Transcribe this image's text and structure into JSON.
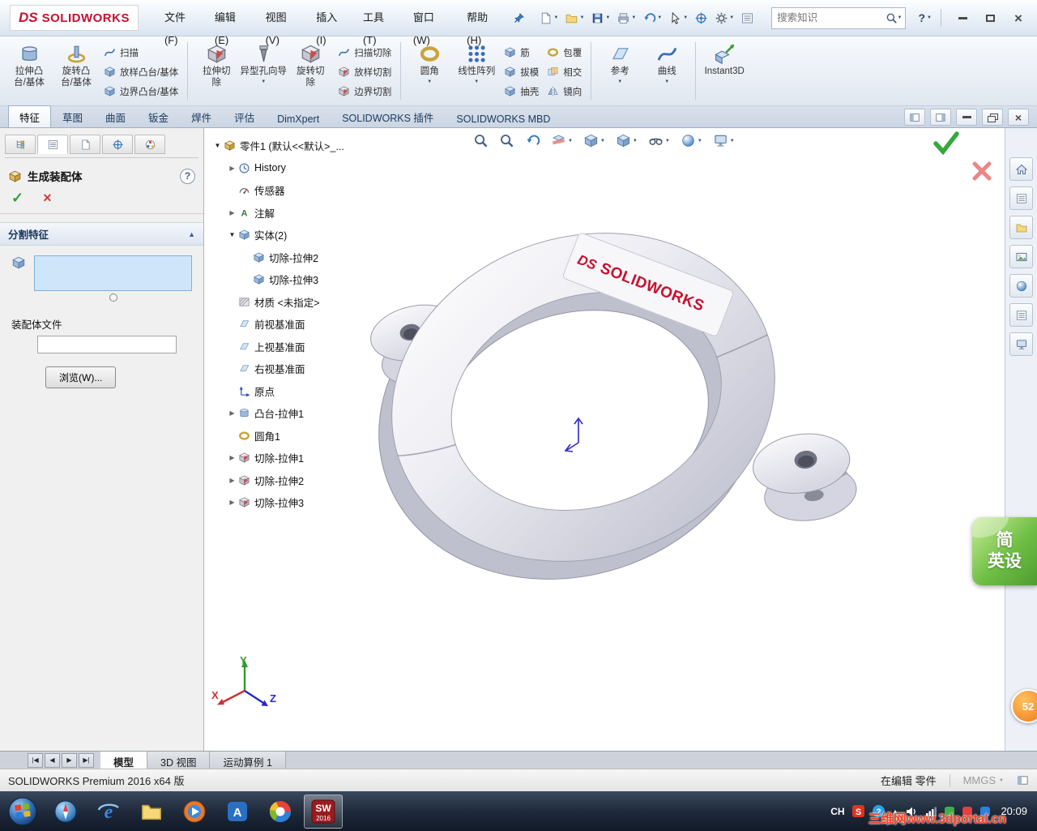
{
  "titlebar": {
    "logo_mark": "DS",
    "logo_text": "SOLIDWORKS",
    "menus": [
      "文件(F)",
      "编辑(E)",
      "视图(V)",
      "插入(I)",
      "工具(T)",
      "窗口(W)",
      "帮助(H)"
    ],
    "quick_buttons": [
      {
        "icon": "new-document",
        "caret": true
      },
      {
        "icon": "open",
        "caret": true
      },
      {
        "icon": "save",
        "caret": true
      },
      {
        "icon": "print",
        "caret": true
      },
      {
        "icon": "undo",
        "caret": true
      },
      {
        "icon": "select",
        "caret": true
      },
      {
        "icon": "rebuild",
        "caret": false
      },
      {
        "icon": "options",
        "caret": true
      },
      {
        "icon": "file-properties",
        "caret": false
      }
    ],
    "search_placeholder": "搜索知识",
    "help_label": "?"
  },
  "command_manager": {
    "tabs": [
      "特征",
      "草图",
      "曲面",
      "钣金",
      "焊件",
      "评估",
      "DimXpert",
      "SOLIDWORKS 插件",
      "SOLIDWORKS MBD"
    ],
    "active_tab": "特征",
    "groups": [
      {
        "columns": [
          {
            "type": "big",
            "icon": "boss-extrude",
            "label": "拉伸凸\n台/基体",
            "caret": false
          },
          {
            "type": "big",
            "icon": "revolve",
            "label": "旋转凸\n台/基体",
            "caret": false
          },
          {
            "type": "stack",
            "items": [
              {
                "icon": "sweep",
                "label": "扫描"
              },
              {
                "icon": "loft",
                "label": "放样凸台/基体"
              },
              {
                "icon": "boundary",
                "label": "边界凸台/基体"
              }
            ]
          }
        ]
      },
      {
        "columns": [
          {
            "type": "big",
            "icon": "cut-extrude",
            "label": "拉伸切\n除",
            "caret": false
          },
          {
            "type": "big",
            "icon": "hole-wizard",
            "label": "异型孔向导",
            "caret": true
          },
          {
            "type": "big",
            "icon": "revolved-cut",
            "label": "旋转切\n除",
            "caret": false
          },
          {
            "type": "stack",
            "items": [
              {
                "icon": "swept-cut",
                "label": "扫描切除"
              },
              {
                "icon": "lofted-cut",
                "label": "放样切割"
              },
              {
                "icon": "boundary-cut",
                "label": "边界切割"
              }
            ]
          }
        ]
      },
      {
        "columns": [
          {
            "type": "big",
            "icon": "fillet",
            "label": "圆角",
            "caret": true
          },
          {
            "type": "big",
            "icon": "linear-pattern",
            "label": "线性阵列",
            "caret": true
          },
          {
            "type": "stack",
            "items": [
              {
                "icon": "rib",
                "label": "筋"
              },
              {
                "icon": "draft",
                "label": "拔模"
              },
              {
                "icon": "shell",
                "label": "抽壳"
              }
            ]
          },
          {
            "type": "stack",
            "items": [
              {
                "icon": "wrap",
                "label": "包覆"
              },
              {
                "icon": "intersect",
                "label": "相交"
              },
              {
                "icon": "mirror",
                "label": "镜向"
              }
            ]
          }
        ]
      },
      {
        "columns": [
          {
            "type": "big",
            "icon": "reference-geometry",
            "label": "参考",
            "caret": true
          },
          {
            "type": "big",
            "icon": "curves",
            "label": "曲线",
            "caret": true
          }
        ]
      },
      {
        "columns": [
          {
            "type": "big",
            "icon": "instant3d",
            "label": "Instant3D",
            "caret": false
          }
        ]
      }
    ]
  },
  "property_manager": {
    "tabs": [
      "feature-manager",
      "property-manager",
      "configuration-manager",
      "dimxpert-manager",
      "display-manager"
    ],
    "title": "生成装配体",
    "help": "?",
    "split_group_title": "分割特征",
    "assembly_file_label": "装配体文件",
    "browse_label": "浏览(W)..."
  },
  "feature_tree": {
    "items": [
      {
        "label": "零件1 (默认<<默认>_...",
        "icon": "part",
        "indent": 0,
        "expander": "expanded"
      },
      {
        "label": "History",
        "icon": "history",
        "indent": 1,
        "expander": "collapsed"
      },
      {
        "label": "传感器",
        "icon": "sensors",
        "indent": 1,
        "expander": "none"
      },
      {
        "label": "注解",
        "icon": "annotations",
        "indent": 1,
        "expander": "collapsed"
      },
      {
        "label": "实体(2)",
        "icon": "solid-bodies",
        "indent": 1,
        "expander": "expanded"
      },
      {
        "label": "切除-拉伸2",
        "icon": "solid-body",
        "indent": 2,
        "expander": "none"
      },
      {
        "label": "切除-拉伸3",
        "icon": "solid-body",
        "indent": 2,
        "expander": "none"
      },
      {
        "label": "材质 <未指定>",
        "icon": "material",
        "indent": 1,
        "expander": "none"
      },
      {
        "label": "前视基准面",
        "icon": "plane",
        "indent": 1,
        "expander": "none"
      },
      {
        "label": "上视基准面",
        "icon": "plane",
        "indent": 1,
        "expander": "none"
      },
      {
        "label": "右视基准面",
        "icon": "plane",
        "indent": 1,
        "expander": "none"
      },
      {
        "label": "原点",
        "icon": "origin",
        "indent": 1,
        "expander": "none"
      },
      {
        "label": "凸台-拉伸1",
        "icon": "boss-extrude",
        "indent": 1,
        "expander": "collapsed"
      },
      {
        "label": "圆角1",
        "icon": "fillet",
        "indent": 1,
        "expander": "none"
      },
      {
        "label": "切除-拉伸1",
        "icon": "cut-extrude",
        "indent": 1,
        "expander": "collapsed"
      },
      {
        "label": "切除-拉伸2",
        "icon": "cut-extrude",
        "indent": 1,
        "expander": "collapsed"
      },
      {
        "label": "切除-拉伸3",
        "icon": "cut-extrude",
        "indent": 1,
        "expander": "collapsed"
      }
    ]
  },
  "viewport": {
    "hud": [
      {
        "icon": "zoom-fit",
        "caret": false
      },
      {
        "icon": "zoom-area",
        "caret": false
      },
      {
        "icon": "previous-view",
        "caret": false
      },
      {
        "icon": "section-view",
        "caret": true
      },
      {
        "icon": "view-orientation",
        "caret": true
      },
      {
        "icon": "display-style",
        "caret": true
      },
      {
        "icon": "hide-show",
        "caret": true
      },
      {
        "icon": "appearances",
        "caret": true
      },
      {
        "icon": "scene",
        "caret": true
      }
    ],
    "decal_logo": "DS",
    "decal_text": "SOLIDWORKS",
    "triad": {
      "x": "X",
      "y": "Y",
      "z": "Z"
    }
  },
  "task_pane": {
    "buttons": [
      "home",
      "design-library",
      "file-explorer",
      "view-palette",
      "appearances-tab",
      "custom-properties",
      "solidworks-forum"
    ]
  },
  "doc_tabs": {
    "tabs": [
      "模型",
      "3D 视图",
      "运动算例 1"
    ],
    "active": "模型"
  },
  "status_bar": {
    "app_version": "SOLIDWORKS Premium 2016 x64 版",
    "editing_status": "在编辑 零件",
    "units": "MMGS"
  },
  "taskbar": {
    "language": "CH",
    "time": "20:09",
    "sw_year": "2016",
    "sogou_letter": "S",
    "qq_mark": "?"
  },
  "overlays": {
    "badge_line1": "简",
    "badge_line2": "英设",
    "count_badge": "52",
    "watermark": "三维网www.3dportal.cn"
  }
}
